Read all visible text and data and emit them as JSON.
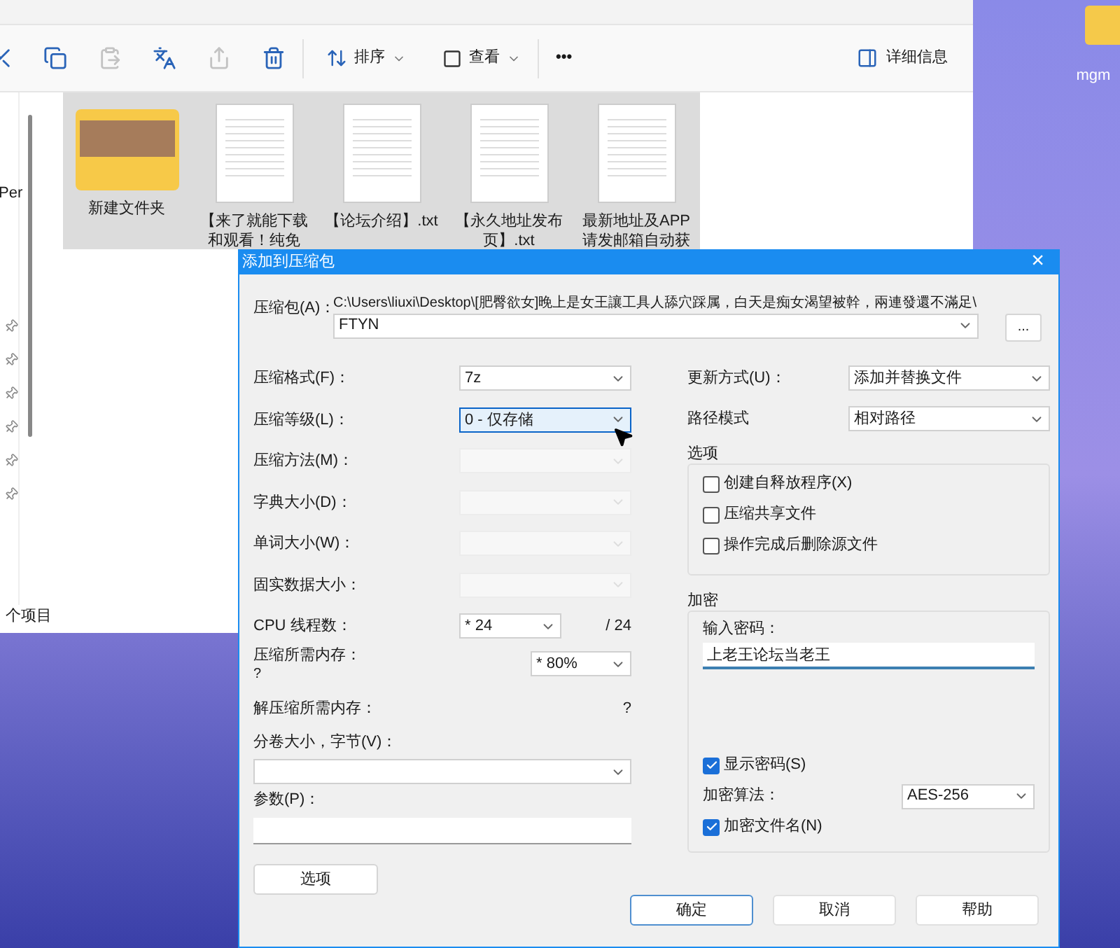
{
  "explorer": {
    "toolbar": {
      "actions": [
        {
          "kind": "cut",
          "disabled": false
        },
        {
          "kind": "copy",
          "disabled": false
        },
        {
          "kind": "paste",
          "disabled": true
        },
        {
          "kind": "rename",
          "disabled": false
        },
        {
          "kind": "share",
          "disabled": true
        },
        {
          "kind": "delete",
          "disabled": false
        }
      ],
      "sort": "排序",
      "view": "查看",
      "more": "•••",
      "details": "详细信息"
    },
    "sidebar": {
      "fragment": "Per"
    },
    "files": [
      {
        "name": "新建文件夹",
        "kind": "folder",
        "selected": true
      },
      {
        "name": "【来了就能下载和观看！纯免",
        "kind": "text",
        "selected": true
      },
      {
        "name": "【论坛介绍】.txt",
        "kind": "text",
        "selected": true
      },
      {
        "name": "【永久地址发布页】.txt",
        "kind": "text",
        "selected": true
      },
      {
        "name": "最新地址及APP请发邮箱自动获",
        "kind": "text",
        "selected": true
      }
    ],
    "status": "个项目"
  },
  "desktop_icon": {
    "label": "mgm"
  },
  "dialog": {
    "title": "添加到压缩包",
    "close": "×",
    "archive": {
      "label": "压缩包(A)：",
      "path": "C:\\Users\\liuxi\\Desktop\\[肥臀欲女]晚上是女王讓工具人舔穴踩属，白天是痴女渴望被幹，兩連發還不滿足\\",
      "value": "FTYN",
      "browse": "..."
    },
    "left_fields": [
      {
        "kind": "combo",
        "label": "压缩格式(F)：",
        "value": "7z",
        "disabled": false,
        "focused": false
      },
      {
        "kind": "combo",
        "label": "压缩等级(L)：",
        "value": "0 - 仅存储",
        "disabled": false,
        "focused": true
      },
      {
        "kind": "combo",
        "label": "压缩方法(M)：",
        "disabled": true,
        "focused": false
      },
      {
        "kind": "combo",
        "label": "字典大小(D)：",
        "disabled": true,
        "focused": false
      },
      {
        "kind": "combo",
        "label": "单词大小(W)：",
        "disabled": true,
        "focused": false
      },
      {
        "kind": "combo",
        "label": "固实数据大小：",
        "disabled": true,
        "focused": false
      },
      {
        "kind": "threads",
        "label": "CPU 线程数：",
        "value": "* 24",
        "suffix": "/ 24"
      },
      {
        "kind": "memory",
        "label": "压缩所需内存：",
        "note": "?",
        "value": "* 80%"
      },
      {
        "kind": "info",
        "label": "解压缩所需内存：",
        "value": "?"
      },
      {
        "kind": "wide_combo",
        "label": "分卷大小，字节(V)："
      },
      {
        "kind": "wide_input",
        "label": "参数(P)："
      }
    ],
    "options_button": "选项",
    "right_fields": [
      {
        "label": "更新方式(U)：",
        "value": "添加并替换文件"
      },
      {
        "label": "路径模式",
        "value": "相对路径"
      }
    ],
    "options_group": {
      "title": "选项",
      "checkboxes": [
        {
          "label": "创建自释放程序(X)",
          "checked": false
        },
        {
          "label": "压缩共享文件",
          "checked": false
        },
        {
          "label": "操作完成后删除源文件",
          "checked": false
        }
      ]
    },
    "encryption": {
      "title": "加密",
      "password_label": "输入密码：",
      "password": "上老王论坛当老王",
      "show_password": {
        "label": "显示密码(S)",
        "checked": true
      },
      "algorithm_label": "加密算法：",
      "algorithm": "AES-256",
      "encrypt_names": {
        "label": "加密文件名(N)",
        "checked": true
      }
    },
    "buttons": [
      {
        "label": "确定",
        "default": true
      },
      {
        "label": "取消",
        "default": false
      },
      {
        "label": "帮助",
        "default": false
      }
    ]
  }
}
